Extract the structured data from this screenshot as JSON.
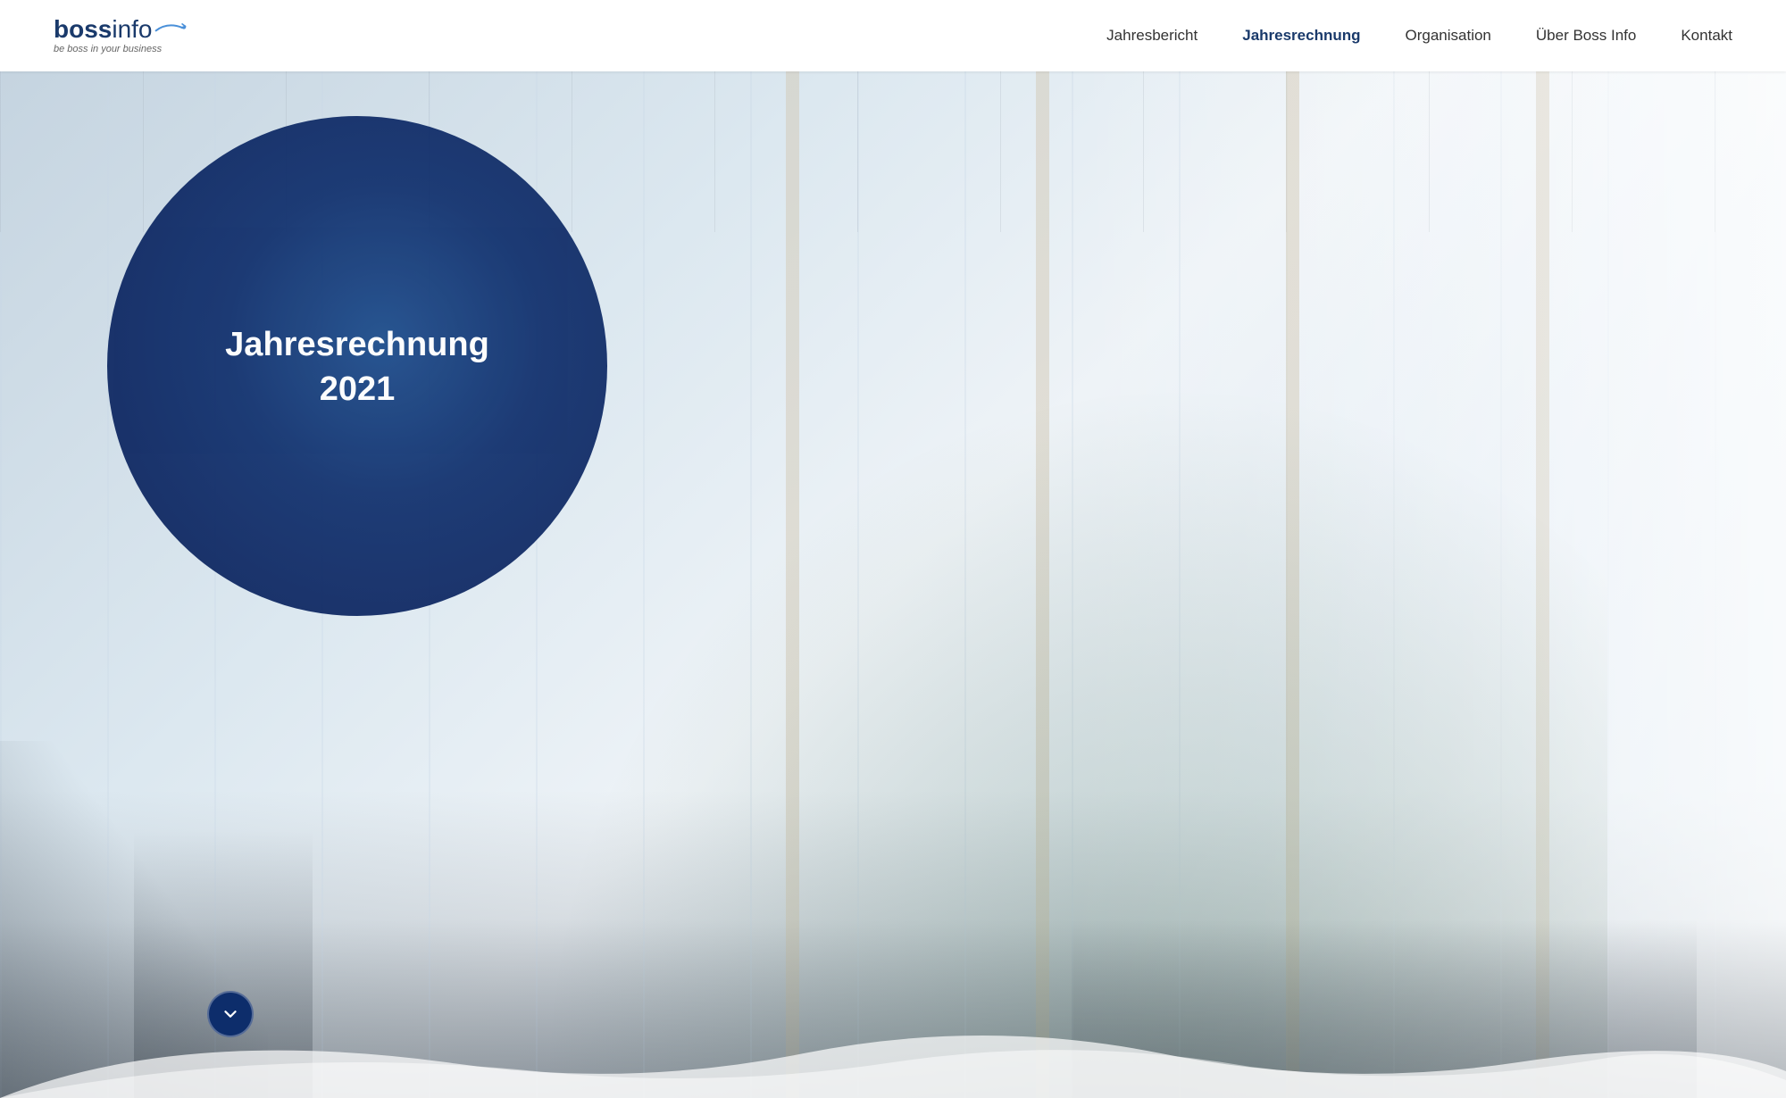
{
  "header": {
    "logo": {
      "bold": "boss",
      "regular": "info",
      "tagline": "be boss in your business"
    },
    "nav": {
      "items": [
        {
          "label": "Jahresbericht",
          "active": false
        },
        {
          "label": "Jahresrechnung",
          "active": true
        },
        {
          "label": "Organisation",
          "active": false
        },
        {
          "label": "Über Boss Info",
          "active": false
        },
        {
          "label": "Kontakt",
          "active": false
        }
      ]
    }
  },
  "hero": {
    "circle": {
      "title": "Jahresrechnung",
      "year": "2021"
    },
    "scroll_button_label": "↓"
  }
}
